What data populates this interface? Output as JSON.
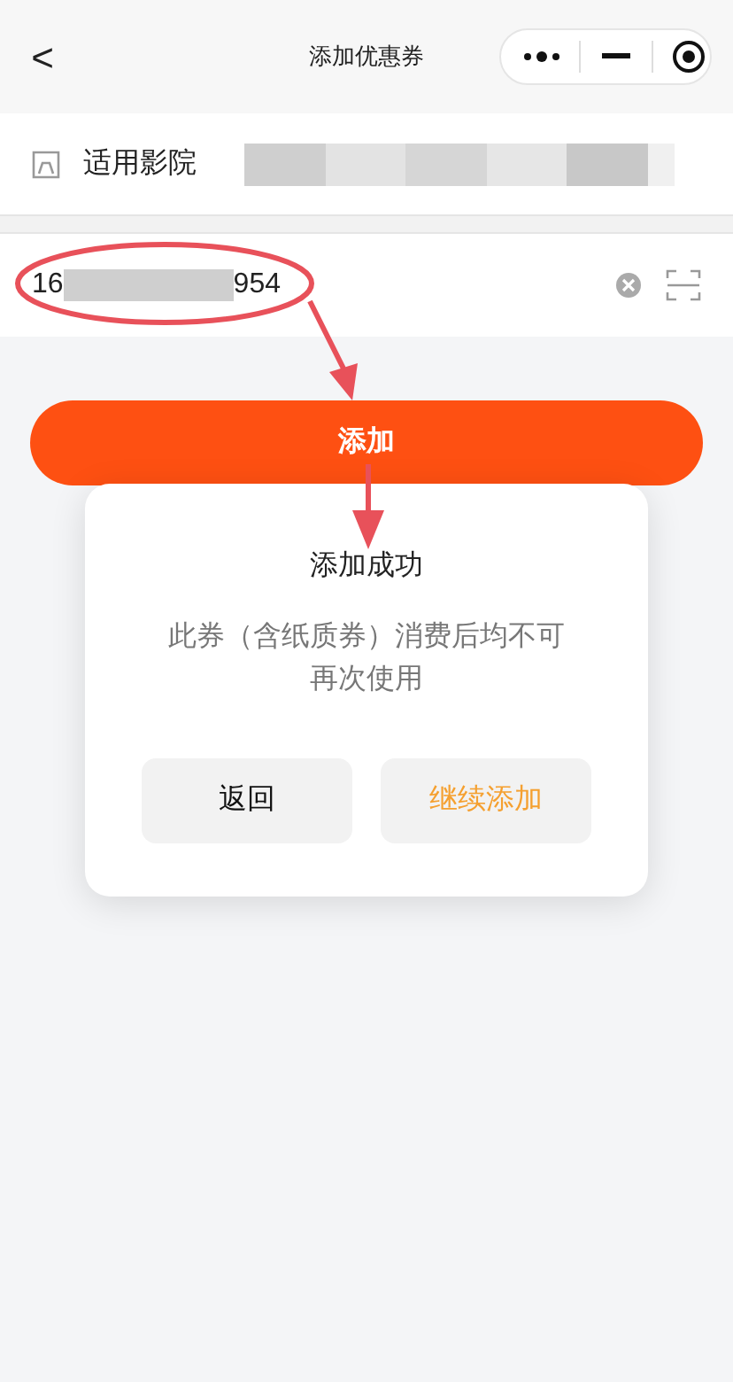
{
  "nav": {
    "back": "<",
    "title": "添加优惠券"
  },
  "cinema": {
    "label": "适用影院"
  },
  "code_field": {
    "value_start": "16",
    "value_end": "954"
  },
  "add_button": "添加",
  "dialog": {
    "title": "添加成功",
    "message": "此券（含纸质券）消费后均不可再次使用",
    "buttons": [
      {
        "label": "返回",
        "kind": "plain"
      },
      {
        "label": "继续添加",
        "kind": "accent"
      }
    ]
  }
}
